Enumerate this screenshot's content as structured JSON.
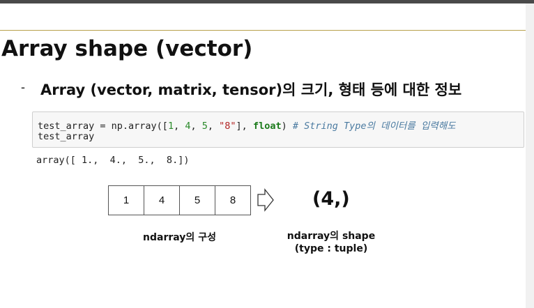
{
  "slide": {
    "title": "Array shape (vector)",
    "bullet_dash": "-",
    "bullet": "Array (vector, matrix, tensor)의 크기, 형태 등에 대한 정보"
  },
  "code": {
    "line1": {
      "t1": "test_array = np.array([",
      "n1": "1",
      "t2": ", ",
      "n2": "4",
      "t3": ", ",
      "n3": "5",
      "t4": ", ",
      "s1": "\"8\"",
      "t5": "], ",
      "kw": "float",
      "t6": ") ",
      "comment": "# String Type의 데이터를 입력해도"
    },
    "line2": "test_array",
    "output": "array([ 1.,  4.,  5.,  8.])"
  },
  "diagram": {
    "cells": [
      "1",
      "4",
      "5",
      "8"
    ],
    "arrow_icon": "hollow-right-arrow",
    "shape_value": "(4,)",
    "caption_left": "ndarray의 구성",
    "caption_right_line1": "ndarray의 shape",
    "caption_right_line2": "(type : tuple)"
  },
  "colors": {
    "top_bar": "#4a4a4a",
    "rule": "#b8a04a",
    "code_bg": "#f7f7f7"
  }
}
